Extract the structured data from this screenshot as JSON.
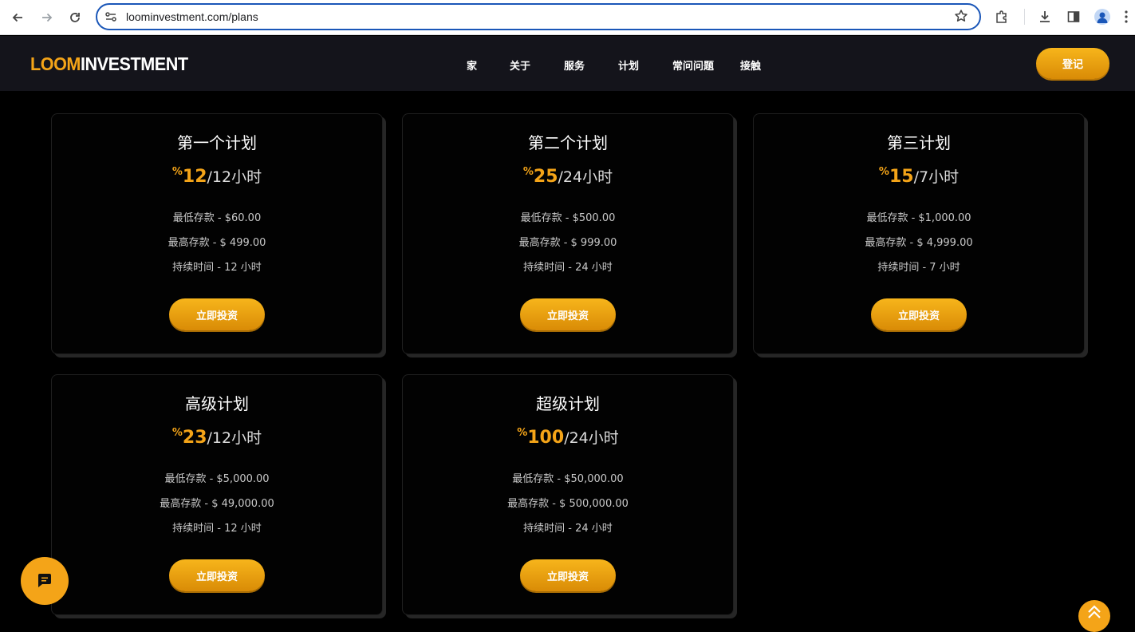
{
  "browser": {
    "url": "loominvestment.com/plans"
  },
  "site": {
    "logo_part1": "LOOM",
    "logo_part2": "INVESTMENT",
    "nav": [
      "家",
      "关于",
      "服务",
      "计划",
      "常问问题",
      "接触"
    ],
    "login_label": "登记"
  },
  "colors": {
    "accent": "#f4a418",
    "header_bg": "#14141b",
    "page_bg": "#000000"
  },
  "plans": [
    {
      "title": "第一个计划",
      "percent_symbol": "%",
      "rate": "12",
      "per": "/12小时",
      "min": "最低存款 - $60.00",
      "max": "最高存款 - $ 499.00",
      "duration": "持续时间 - 12 小时",
      "button": "立即投资"
    },
    {
      "title": "第二个计划",
      "percent_symbol": "%",
      "rate": "25",
      "per": "/24小时",
      "min": "最低存款 - $500.00",
      "max": "最高存款 - $ 999.00",
      "duration": "持续时间 - 24 小时",
      "button": "立即投资"
    },
    {
      "title": "第三计划",
      "percent_symbol": "%",
      "rate": "15",
      "per": "/7小时",
      "min": "最低存款 - $1,000.00",
      "max": "最高存款 - $ 4,999.00",
      "duration": "持续时间 - 7 小时",
      "button": "立即投资"
    },
    {
      "title": "高级计划",
      "percent_symbol": "%",
      "rate": "23",
      "per": "/12小时",
      "min": "最低存款 - $5,000.00",
      "max": "最高存款 - $ 49,000.00",
      "duration": "持续时间 - 12 小时",
      "button": "立即投资"
    },
    {
      "title": "超级计划",
      "percent_symbol": "%",
      "rate": "100",
      "per": "/24小时",
      "min": "最低存款 - $50,000.00",
      "max": "最高存款 - $ 500,000.00",
      "duration": "持续时间 - 24 小时",
      "button": "立即投资"
    }
  ],
  "floating": {
    "chat_icon": "chat-bubble-icon",
    "top_icon": "double-chevron-up-icon"
  }
}
